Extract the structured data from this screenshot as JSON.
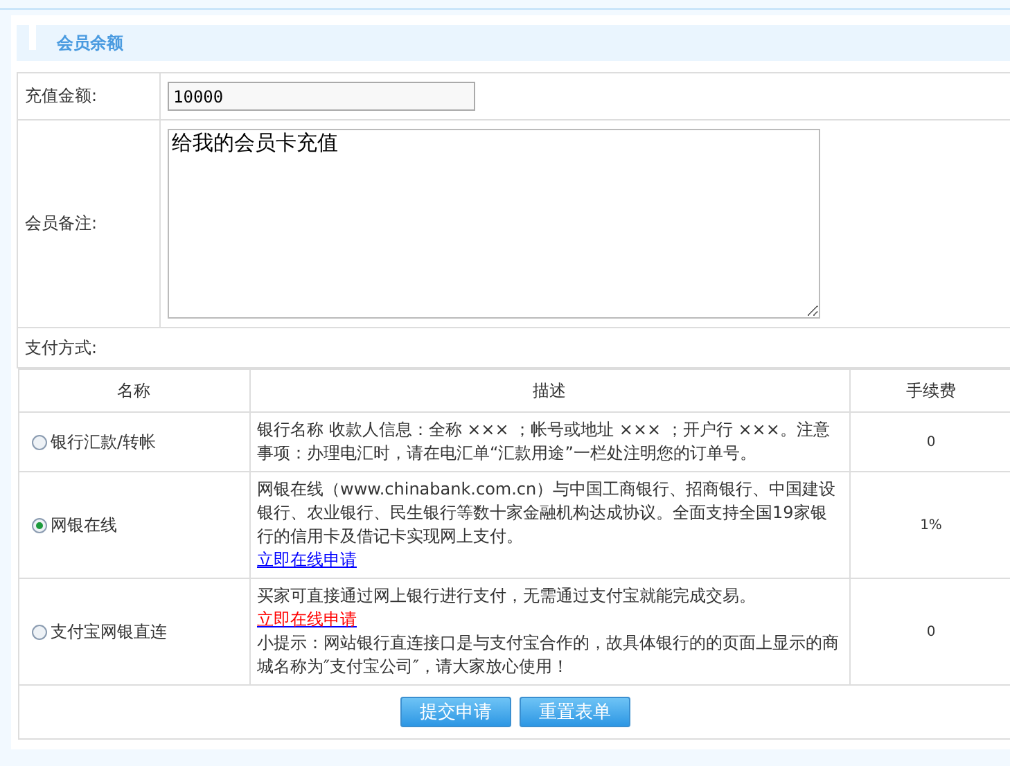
{
  "section_title": "会员余额",
  "form": {
    "amount_label": "充值金额:",
    "amount_value": "10000",
    "note_label": "会员备注:",
    "note_value": "给我的会员卡充值",
    "payment_label": "支付方式:"
  },
  "table": {
    "columns": [
      "名称",
      "描述",
      "手续费"
    ],
    "rows": [
      {
        "name": "银行汇款/转帐",
        "selected": false,
        "fee": "0",
        "description": [
          {
            "kind": "text",
            "text": "银行名称 收款人信息：全称 ××× ；帐号或地址 ××× ；开户行 ×××。注意事项：办理电汇时，请在电汇单“汇款用途”一栏处注明您的订单号。"
          }
        ]
      },
      {
        "name": "网银在线",
        "selected": true,
        "fee": "1%",
        "description": [
          {
            "kind": "text",
            "text": "网银在线（www.chinabank.com.cn）与中国工商银行、招商银行、中国建设银行、农业银行、民生银行等数十家金融机构达成协议。全面支持全国19家银行的信用卡及借记卡实现网上支付。"
          },
          {
            "kind": "link",
            "text": "立即在线申请",
            "color": "#0000ff"
          }
        ]
      },
      {
        "name": "支付宝网银直连",
        "selected": false,
        "fee": "0",
        "description": [
          {
            "kind": "text",
            "text": "买家可直接通过网上银行进行支付，无需通过支付宝就能完成交易。"
          },
          {
            "kind": "link",
            "text": "立即在线申请",
            "color": "#ff0000"
          },
          {
            "kind": "text",
            "text": "小提示：网站银行直连接口是与支付宝合作的，故具体银行的的页面上显示的商城名称为″支付宝公司″，请大家放心使用！"
          }
        ]
      }
    ]
  },
  "buttons": [
    "提交申请",
    "重置表单"
  ]
}
